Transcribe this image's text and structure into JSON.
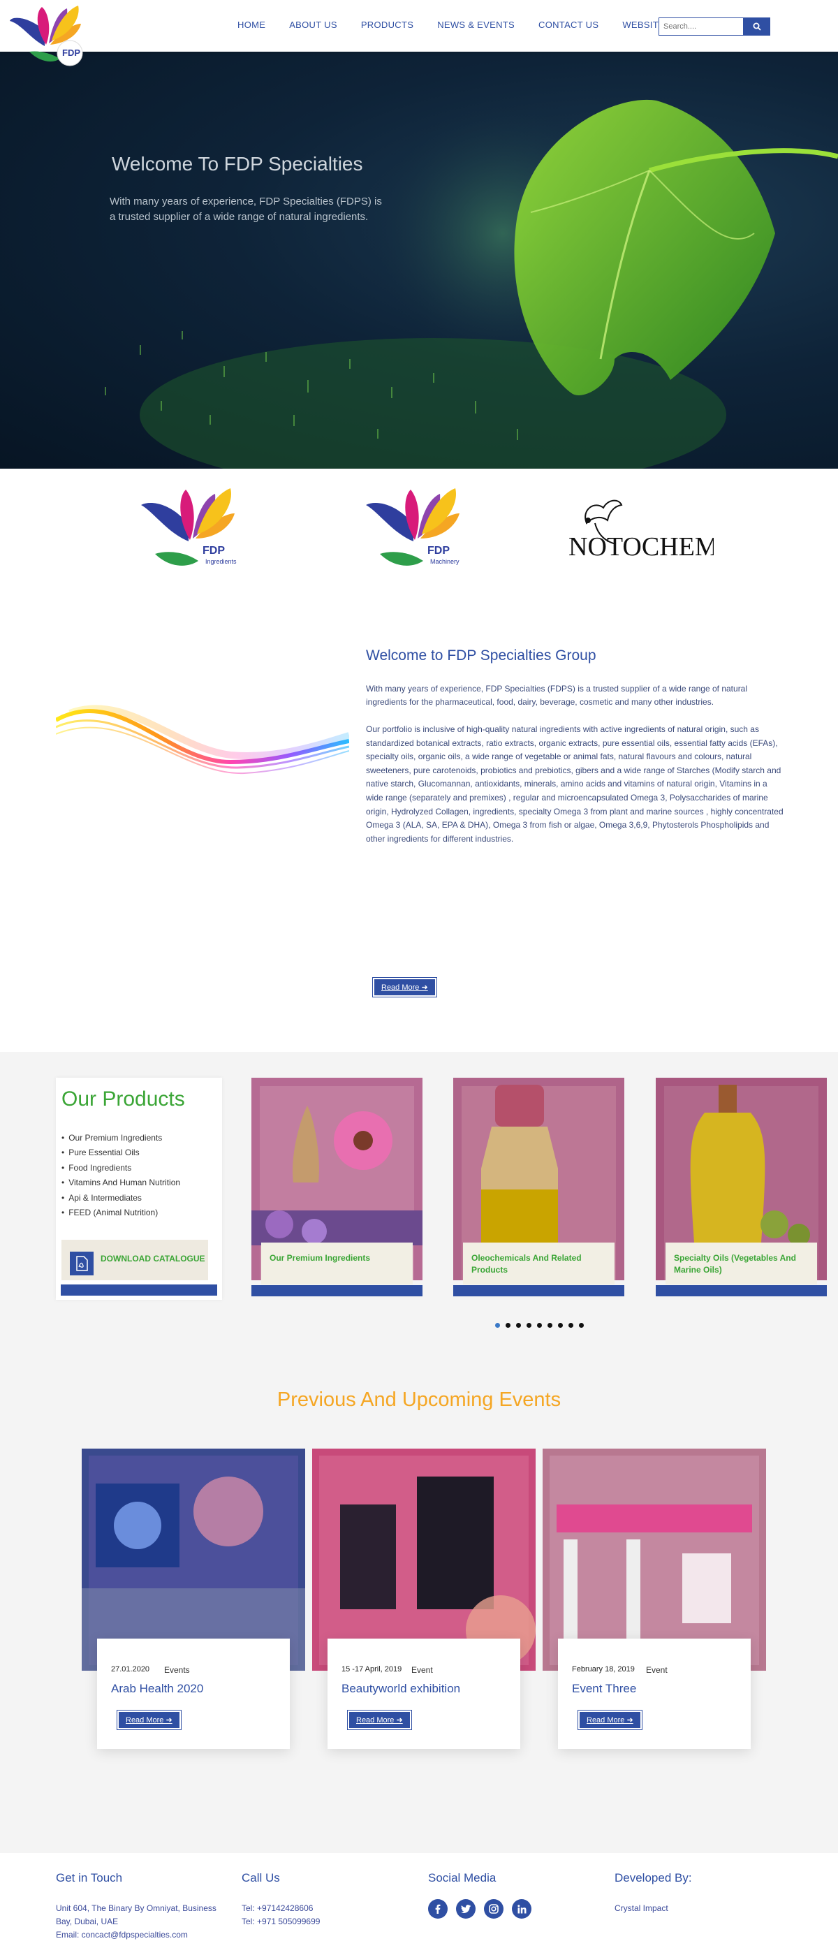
{
  "header": {
    "nav": [
      "HOME",
      "ABOUT US",
      "PRODUCTS",
      "NEWS & EVENTS",
      "CONTACT US",
      "WEBSITES"
    ],
    "search_placeholder": "Search....",
    "logo_text": "FDP"
  },
  "hero": {
    "title": "Welcome To FDP Specialties",
    "text": "With many years of experience, FDP Specialties (FDPS) is a trusted supplier of a wide range of natural ingredients."
  },
  "brands": [
    {
      "name": "FDP",
      "sub": "Ingredients"
    },
    {
      "name": "FDP",
      "sub": "Machinery"
    },
    {
      "name": "NOTOCHEM"
    }
  ],
  "welcome": {
    "title": "Welcome to FDP Specialties Group",
    "p1": "With many years of experience, FDP Specialties (FDPS) is a trusted supplier of a wide range of natural ingredients for the pharmaceutical, food, dairy, beverage, cosmetic and many other industries.",
    "p2": "Our portfolio is inclusive of high-quality natural ingredients with active ingredients of natural origin, such as standardized botanical extracts, ratio extracts, organic extracts, pure essential oils, essential fatty acids (EFAs), specialty oils, organic oils, a wide range of vegetable or animal fats, natural flavours and colours, natural sweeteners, pure carotenoids, probiotics and prebiotics, gibers and a wide range of Starches (Modify starch and native starch, Glucomannan, antioxidants, minerals, amino acids and vitamins of natural origin, Vitamins in a wide range (separately and premixes) , regular and microencapsulated Omega 3, Polysaccharides of marine origin, Hydrolyzed Collagen, ingredients, specialty Omega 3 from plant and marine sources , highly concentrated Omega 3 (ALA, SA, EPA & DHA), Omega 3 from fish or algae, Omega 3,6,9, Phytosterols Phospholipids and other ingredients for different industries.",
    "button": "Read More ➜"
  },
  "products": {
    "title": "Our Products",
    "list": [
      "Our Premium Ingredients",
      "Pure Essential Oils",
      "Food Ingredients",
      "Vitamins And Human Nutrition",
      "Api & Intermediates",
      "FEED (Animal Nutrition)"
    ],
    "catalogue": "DOWNLOAD CATALOGUE",
    "cards": [
      "Our Premium Ingredients",
      "Oleochemicals And Related Products",
      "Specialty Oils (Vegetables And Marine Oils)"
    ],
    "dots": 9,
    "active_dot": 0
  },
  "events": {
    "title": "Previous And Upcoming Events",
    "items": [
      {
        "date": "27.01.2020",
        "category": "Events",
        "name": "Arab Health 2020",
        "button": "Read More ➜"
      },
      {
        "date": "15 -17 April, 2019",
        "category": "Event",
        "name": "Beautyworld exhibition",
        "button": "Read More ➜"
      },
      {
        "date": "February 18, 2019",
        "category": "Event",
        "name": "Event Three",
        "button": "Read More ➜"
      }
    ]
  },
  "footer": {
    "touch_title": "Get in Touch",
    "address": "Unit 604, The Binary By Omniyat, Business Bay, Dubai, UAE",
    "email": "Email: concact@fdpspecialties.com",
    "call_title": "Call Us",
    "tel1": "Tel: +97142428606",
    "tel2": "Tel: +971 505099699",
    "social_title": "Social Media",
    "social": [
      "facebook-icon",
      "twitter-icon",
      "instagram-icon",
      "linkedin-icon"
    ],
    "dev_title": "Developed By:",
    "dev_name": "Crystal Impact"
  }
}
